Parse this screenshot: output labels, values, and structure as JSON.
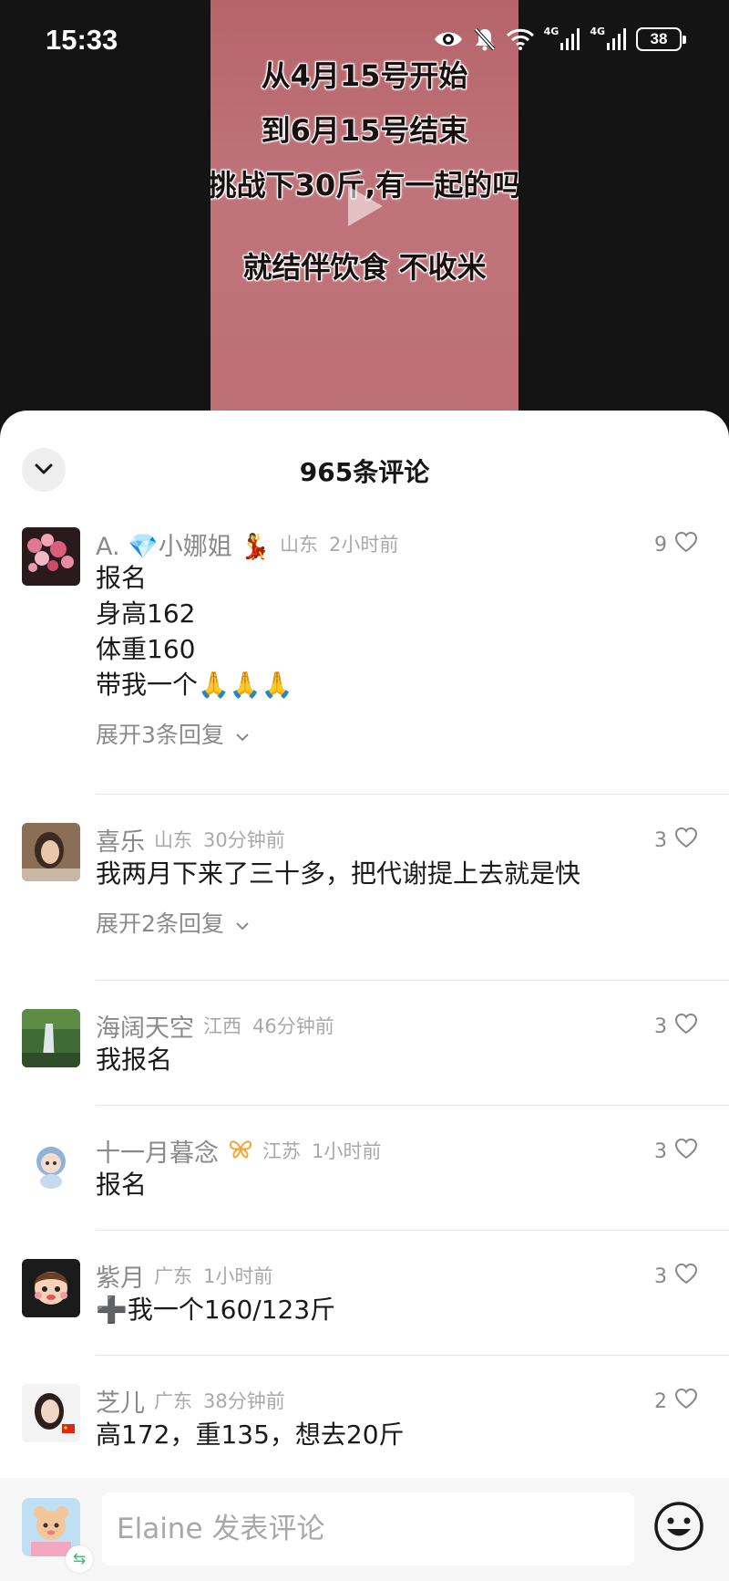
{
  "status_bar": {
    "time": "15:33",
    "network_1": "4G",
    "network_2": "4G",
    "battery": "38"
  },
  "video": {
    "lines": [
      "从4月15号开始",
      "到6月15号结束",
      "挑战下30斤,有一起的吗",
      "就结伴饮食 不收米"
    ]
  },
  "sheet": {
    "title": "965条评论"
  },
  "comments": [
    {
      "name": "A. 💎小娜姐 💃",
      "location": "山东",
      "time": "2小时前",
      "lines": [
        "报名",
        "身高162",
        "体重160",
        "带我一个🙏🙏🙏"
      ],
      "replies": "展开3条回复",
      "likes": "9"
    },
    {
      "name": "喜乐",
      "location": "山东",
      "time": "30分钟前",
      "lines": [
        "我两月下来了三十多，把代谢提上去就是快"
      ],
      "replies": "展开2条回复",
      "likes": "3"
    },
    {
      "name": "海阔天空",
      "location": "江西",
      "time": "46分钟前",
      "lines": [
        "我报名"
      ],
      "likes": "3"
    },
    {
      "name": "十一月暮念",
      "location": "江苏",
      "time": "1小时前",
      "lines": [
        "报名"
      ],
      "likes": "3"
    },
    {
      "name": "紫月",
      "location": "广东",
      "time": "1小时前",
      "lines": [
        "➕我一个160/123斤"
      ],
      "likes": "3"
    },
    {
      "name": "芝儿",
      "location": "广东",
      "time": "38分钟前",
      "lines": [
        "高172，重135，想去20斤"
      ],
      "likes": "2"
    }
  ],
  "input_bar": {
    "placeholder": "Elaine 发表评论"
  },
  "icons": {
    "collapse": "chevron-down-icon",
    "like": "heart-outline-icon",
    "replies": "chevron-down-icon",
    "emoji": "smiley-icon",
    "switch": "switch-arrows-icon"
  }
}
